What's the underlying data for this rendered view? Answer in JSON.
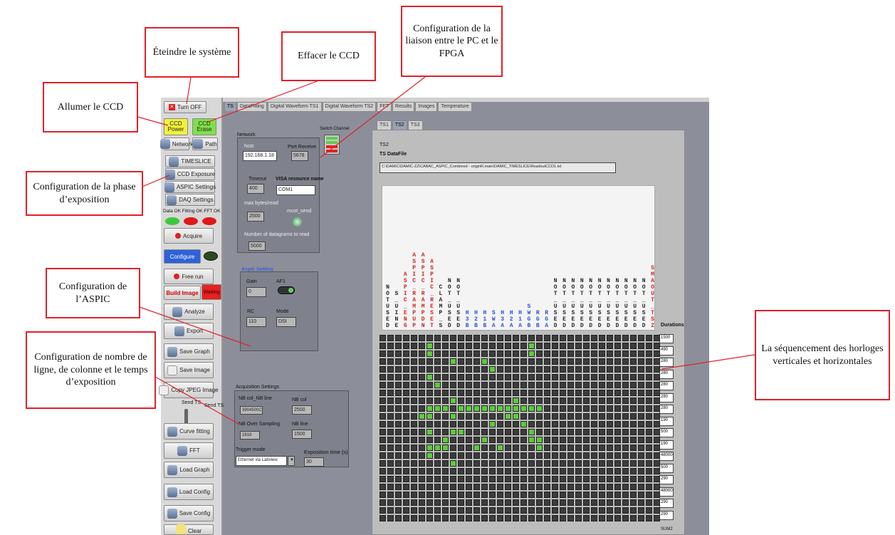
{
  "annotations": {
    "eteindre": "Éteindre le système",
    "effacer": "Effacer le CCD",
    "liaison": "Configuration de la liaison entre le PC et le FPGA",
    "allumer": "Allumer le CCD",
    "exposition": "Configuration de la phase d’exposition",
    "aspic": "Configuration de l’ASPIC",
    "nombre": "Configuration de nombre de ligne, de colonne et le temps d’exposition",
    "sequencement": "La séquencement des horloges verticales et horizontales"
  },
  "sidebar": {
    "turn_off": "Turn OFF",
    "ccd_power": "CCD Power",
    "ccd_erase": "CCD Erase",
    "network": "Network",
    "path": "Path",
    "timeslice": "TIMESLICE",
    "ccd_exposure": "CCD Exposure",
    "aspic_settings": "ASPIC Settings",
    "daq_settings": "DAQ Settings",
    "status": "Data OK Fitting OK FFT OK",
    "acquire": "Acquire",
    "configure": "Configure",
    "free_run": "Free run",
    "build_image": "Build Image",
    "waiting": "Waiting",
    "analyze": "Analyze",
    "export": "Export",
    "save_graph": "Save Graph",
    "save_image": "Save Image",
    "copy_jpeg": "Copy JPEG Image",
    "send_ts": "Send TS",
    "send_ts2": "Send TS",
    "curve_fitting": "Curve fitting",
    "fft": "FFT",
    "load_graph": "Load Graph",
    "load_config": "Load Config",
    "save_config": "Save Config",
    "clear": "Clear"
  },
  "tabs": [
    "TS",
    "DataFitting",
    "Digital Waveform TS1",
    "Digital Waveform TS2",
    "FFT",
    "Results",
    "Images",
    "Temperature"
  ],
  "network": {
    "title": "Network",
    "host_label": "host",
    "host": "192.168.1.18",
    "port_label": "Port Receive",
    "port": "5678",
    "timeout_label": "Timeout",
    "timeout": "400",
    "visa_label": "VISA resource name",
    "visa": "COM1",
    "max_label": "max bytes/read",
    "max": "2500",
    "must_send": "must_send",
    "datagrams_label": "Number of datagrams to read",
    "datagrams": "5000",
    "switch_channel": "Switch Channel"
  },
  "aspic": {
    "title": "Aspic Setting",
    "gain_label": "Gain",
    "gain": "0",
    "af1": "AF1",
    "rc_label": "RC",
    "rc": "110",
    "mode_label": "Mode",
    "mode": "DSI"
  },
  "acq": {
    "title": "Acquisition Settings",
    "ncol_nline": "NB col_NB line",
    "ncol_nline_v": "3904500C",
    "ncol_label": "NB col",
    "ncol": "2500",
    "oversamp_label": "NB Over Sampling",
    "oversamp": "1818",
    "nline_label": "NB line",
    "nline": "1500",
    "trigger_label": "Trigger mode",
    "trigger": "Ethernet via Labview",
    "exp_label": "Exposition time (s)",
    "exp": "30"
  },
  "ts": {
    "subtabs": [
      "TS1",
      "TS2",
      "TS3"
    ],
    "sub_title": "TS2",
    "datafile_label": "TS DataFile",
    "datafile": "C:\\DAMIC\\DAMIC-ZZ\\CABAC_ASPIC_Combined - originR.main\\DAMIC_TIMESLICE\\ReadoutCCD1.txt",
    "durations_label": "Durations",
    "durations": [
      "1500",
      "490",
      "280",
      "280",
      "280",
      "280",
      "280",
      "190",
      "500",
      "190",
      "48000",
      "500",
      "290",
      "48000",
      "290",
      "290"
    ],
    "sum": "SUM2"
  },
  "signals": [
    {
      "t": "NOTUSED",
      "c": "#222"
    },
    {
      "t": "S_UINE",
      "c": "#222"
    },
    {
      "t": "ASPIC_ENG",
      "c": "#c22"
    },
    {
      "t": "ASPIC_RAMPUP",
      "c": "#c22"
    },
    {
      "t": "ASPIC_RAMPDN",
      "c": "#c22"
    },
    {
      "t": "ASPIC_RESET",
      "c": "#c22"
    },
    {
      "t": "CLAMP_S",
      "c": "#222"
    },
    {
      "t": "NOT_USED",
      "c": "#222"
    },
    {
      "t": "NOT_USED",
      "c": "#222"
    },
    {
      "t": "H3B",
      "c": "#2a4fd0"
    },
    {
      "t": "H2B",
      "c": "#2a4fd0"
    },
    {
      "t": "H1B",
      "c": "#2a4fd0"
    },
    {
      "t": "SWA",
      "c": "#2a4fd0"
    },
    {
      "t": "H3A",
      "c": "#2a4fd0"
    },
    {
      "t": "H2A",
      "c": "#2a4fd0"
    },
    {
      "t": "H1A",
      "c": "#2a4fd0"
    },
    {
      "t": "SWGB",
      "c": "#2a4fd0"
    },
    {
      "t": "RGB",
      "c": "#2a4fd0"
    },
    {
      "t": "RGA",
      "c": "#2a4fd0"
    },
    {
      "t": "NOT_USED",
      "c": "#222"
    },
    {
      "t": "NOT_USED",
      "c": "#222"
    },
    {
      "t": "NOT_USED",
      "c": "#222"
    },
    {
      "t": "NOT_USED",
      "c": "#222"
    },
    {
      "t": "NOT_USED",
      "c": "#222"
    },
    {
      "t": "NOT_USED",
      "c": "#222"
    },
    {
      "t": "NOT_USED",
      "c": "#222"
    },
    {
      "t": "NOT_USED",
      "c": "#222"
    },
    {
      "t": "NOT_USED",
      "c": "#222"
    },
    {
      "t": "NOT_USED",
      "c": "#222"
    },
    {
      "t": "NOT_USED",
      "c": "#222"
    },
    {
      "t": "SMAOUT_TS2",
      "c": "#c22"
    }
  ],
  "grid_green": [
    [
      1,
      6
    ],
    [
      2,
      6
    ],
    [
      5,
      6
    ],
    [
      9,
      6
    ],
    [
      10,
      6
    ],
    [
      12,
      6
    ],
    [
      14,
      6
    ],
    [
      15,
      6
    ],
    [
      6,
      7
    ],
    [
      9,
      7
    ],
    [
      14,
      7
    ],
    [
      9,
      8
    ],
    [
      13,
      8
    ],
    [
      14,
      8
    ],
    [
      8,
      9
    ],
    [
      10,
      9
    ],
    [
      12,
      9
    ],
    [
      16,
      9
    ],
    [
      9,
      10
    ],
    [
      12,
      10
    ],
    [
      9,
      11
    ],
    [
      9,
      12
    ],
    [
      14,
      12
    ],
    [
      9,
      13
    ],
    [
      13,
      13
    ],
    [
      9,
      14
    ],
    [
      11,
      14
    ],
    [
      9,
      15
    ],
    [
      14,
      15
    ],
    [
      9,
      16
    ],
    [
      8,
      17
    ],
    [
      9,
      17
    ],
    [
      10,
      17
    ],
    [
      9,
      18
    ],
    [
      11,
      18
    ],
    [
      9,
      19
    ],
    [
      13,
      19
    ],
    [
      9,
      20
    ],
    [
      14,
      20
    ],
    [
      10,
      5
    ],
    [
      3,
      13
    ],
    [
      4,
      14
    ],
    [
      1,
      19
    ],
    [
      2,
      19
    ],
    [
      12,
      19
    ],
    [
      13,
      20
    ],
    [
      10,
      16
    ],
    [
      3,
      9
    ]
  ]
}
